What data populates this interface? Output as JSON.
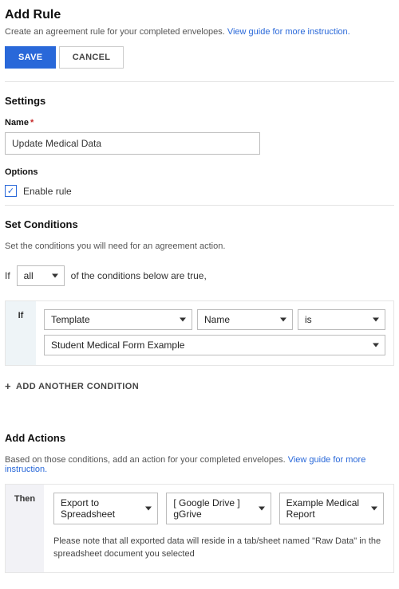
{
  "header": {
    "title": "Add Rule",
    "subtitle_text": "Create an agreement rule for your completed envelopes. ",
    "subtitle_link": "View guide for more instruction."
  },
  "buttons": {
    "save": "SAVE",
    "cancel": "CANCEL"
  },
  "settings": {
    "section_title": "Settings",
    "name_label": "Name",
    "name_value": "Update Medical Data",
    "options_label": "Options",
    "enable_rule_label": "Enable rule",
    "enable_rule_checkmark": "✓"
  },
  "conditions": {
    "section_title": "Set Conditions",
    "intro": "Set the conditions you will need for an agreement action.",
    "if_text": "If",
    "match_mode": "all",
    "match_tail": "of the conditions below are true,",
    "gutter_label": "If",
    "field": "Template",
    "property": "Name",
    "operator": "is",
    "value": "Student Medical Form Example",
    "add_another": "ADD ANOTHER CONDITION"
  },
  "actions": {
    "section_title": "Add Actions",
    "intro_text": "Based on those conditions, add an action for your completed envelopes. ",
    "intro_link": "View guide for more instruction.",
    "gutter_label": "Then",
    "action_type": "Export to Spreadsheet",
    "destination": "[ Google Drive ] gGrive",
    "target": "Example Medical Report",
    "note": "Please note that all exported data will reside in a tab/sheet named \"Raw Data\" in the spreadsheet document you selected"
  }
}
